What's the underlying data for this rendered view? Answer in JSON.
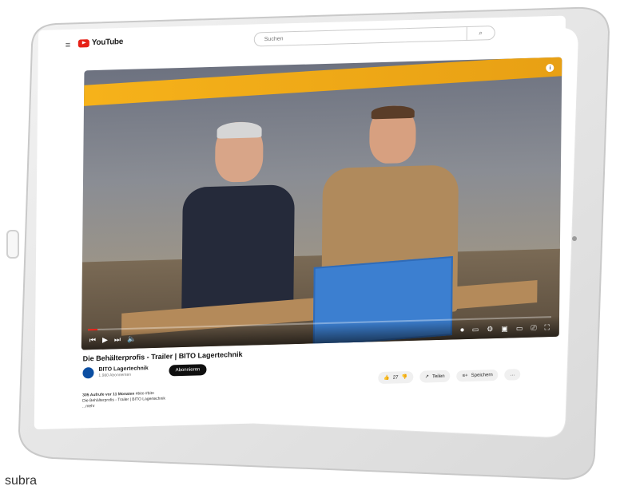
{
  "topbar": {
    "logo_text": "YouTube",
    "search_placeholder": "Suchen"
  },
  "video": {
    "progress_fraction": 0.02,
    "title": "Die Behälterprofis - Trailer | BITO Lagertechnik"
  },
  "channel": {
    "name": "BITO Lagertechnik",
    "subscribers": "1.980 Abonnenten",
    "subscribe_label": "Abonnieren"
  },
  "actions": {
    "likes": "27",
    "share_label": "Teilen",
    "save_label": "Speichern"
  },
  "description": {
    "meta": "305 Aufrufe vor 11 Monaten",
    "tags": "#bito #bito",
    "line1": "Die Behälterprofis - Trailer | BITO Lagertechnik",
    "more": "...mehr"
  },
  "watermark": "subra"
}
